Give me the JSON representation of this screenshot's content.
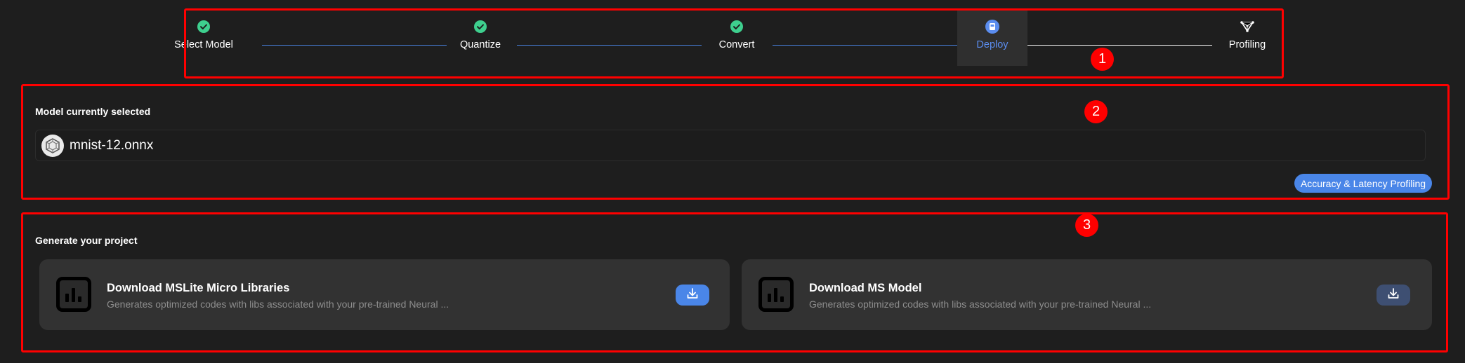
{
  "stepper": {
    "steps": [
      {
        "label": "Select Model",
        "status": "done",
        "icon": "check-circle-icon"
      },
      {
        "label": "Quantize",
        "status": "done",
        "icon": "check-circle-icon"
      },
      {
        "label": "Convert",
        "status": "done",
        "icon": "check-circle-icon"
      },
      {
        "label": "Deploy",
        "status": "active",
        "icon": "deploy-icon"
      },
      {
        "label": "Profiling",
        "status": "pending",
        "icon": "profiling-icon"
      }
    ],
    "active_color": "#5b8def",
    "done_color": "#3ecf8e"
  },
  "model_section": {
    "title": "Model currently selected",
    "model_name": "mnist-12.onnx",
    "model_icon": "onnx-logo-icon",
    "profiling_button_label": "Accuracy & Latency Profiling"
  },
  "project_section": {
    "title": "Generate your project",
    "cards": [
      {
        "title": "Download MSLite Micro Libraries",
        "description": "Generates optimized codes with libs associated with your pre-trained Neural ...",
        "icon": "bar-chart-icon",
        "button_icon": "download-icon",
        "button_color": "#4a86e8"
      },
      {
        "title": "Download MS Model",
        "description": "Generates optimized codes with libs associated with your pre-trained Neural ...",
        "icon": "bar-chart-icon",
        "button_icon": "download-icon",
        "button_color": "#3e4f72"
      }
    ]
  },
  "annotations": [
    "1",
    "2",
    "3"
  ],
  "colors": {
    "background": "#1e1e1e",
    "accent": "#4a86e8",
    "annotation": "#ff0000"
  }
}
